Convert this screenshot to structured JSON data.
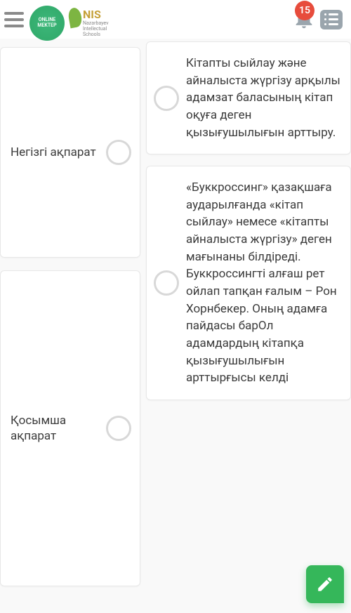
{
  "header": {
    "logo_om_line1": "ONLINE",
    "logo_om_line2": "MEKTEP",
    "nis_main": "NIS",
    "nis_sub1": "Nazarbayev",
    "nis_sub2": "Intellectual",
    "nis_sub3": "Schools",
    "notification_count": "15"
  },
  "left": {
    "card1_label": "Негізгі ақпарат",
    "card2_label": "Қосымша ақпарат"
  },
  "right": {
    "card1_text": "Кітапты сыйлау және айналыста жүргізу арқылы адамзат баласының кітап оқуға деген қызығушылығын арттыру.",
    "card2_text": "«Буккроссинг» қазақшаға аударылғанда «кітап сыйлау» немесе «кітапты айналыста жүргізу» деген мағынаны білдіреді. Буккроссингті алғаш рет ойлап тапқан ғалым – Рон Хорнбекер. Оның адамға пайдасы барОл адамдардың кітапқа қызығушылығын арттырғысы келді"
  }
}
